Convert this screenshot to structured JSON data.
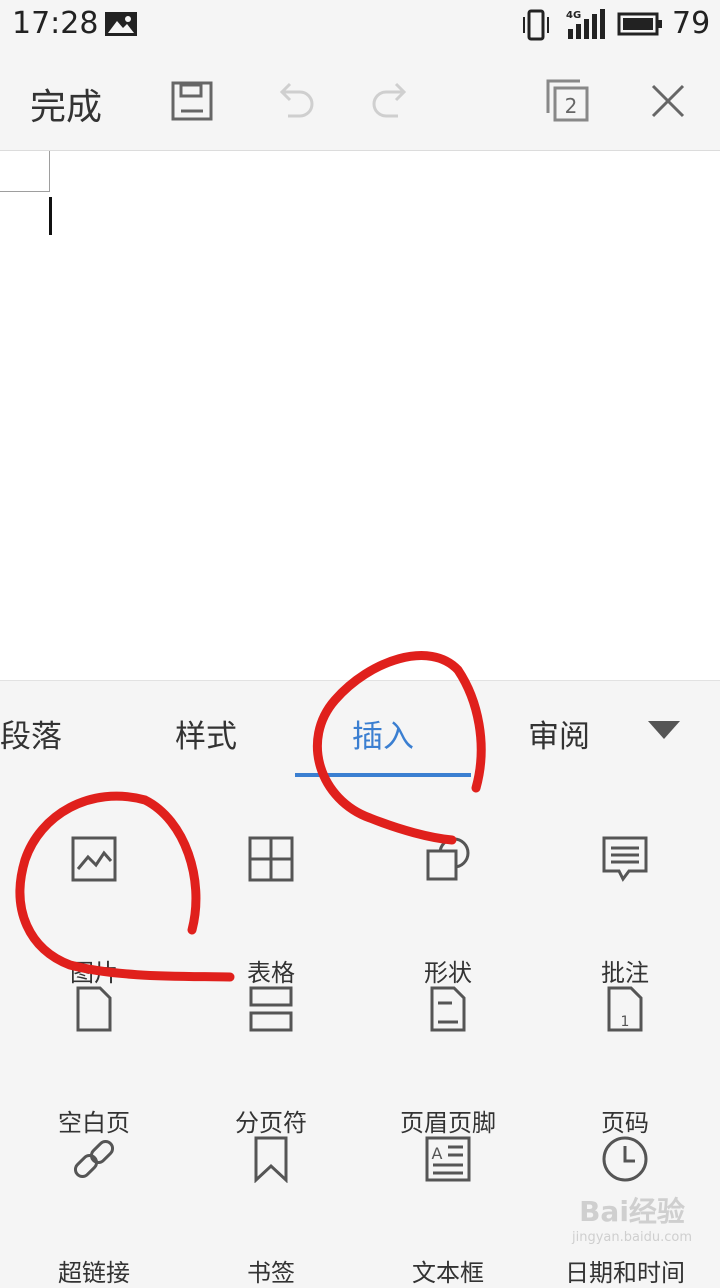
{
  "status_bar": {
    "time": "17:28",
    "network": "4G",
    "battery": "79"
  },
  "toolbar": {
    "done_label": "完成",
    "save_icon": "save-icon",
    "undo_icon": "undo-icon",
    "redo_icon": "redo-icon",
    "windows_count": "2",
    "close_icon": "close-icon"
  },
  "tabs": [
    {
      "label": "段落",
      "active": false
    },
    {
      "label": "样式",
      "active": false
    },
    {
      "label": "插入",
      "active": true
    },
    {
      "label": "审阅",
      "active": false
    }
  ],
  "insert_items": [
    {
      "label": "图片",
      "icon": "image-icon"
    },
    {
      "label": "表格",
      "icon": "table-icon"
    },
    {
      "label": "形状",
      "icon": "shape-icon"
    },
    {
      "label": "批注",
      "icon": "comment-icon"
    },
    {
      "label": "空白页",
      "icon": "blank-page-icon"
    },
    {
      "label": "分页符",
      "icon": "page-break-icon"
    },
    {
      "label": "页眉页脚",
      "icon": "header-footer-icon"
    },
    {
      "label": "页码",
      "icon": "page-number-icon"
    },
    {
      "label": "超链接",
      "icon": "hyperlink-icon"
    },
    {
      "label": "书签",
      "icon": "bookmark-icon"
    },
    {
      "label": "文本框",
      "icon": "text-box-icon"
    },
    {
      "label": "日期和时间",
      "icon": "clock-icon"
    }
  ],
  "watermark": {
    "logo": "Bai经验",
    "url": "jingyan.baidu.com"
  },
  "colors": {
    "accent": "#3b7fd1",
    "annotation": "#e0201c",
    "icon": "#555555"
  }
}
